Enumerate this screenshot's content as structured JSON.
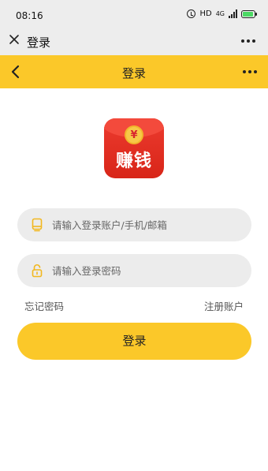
{
  "status_bar": {
    "time": "08:16",
    "hd": "HD",
    "network": "4G",
    "battery_text": "92"
  },
  "wx_bar": {
    "title": "登录"
  },
  "nav": {
    "title": "登录"
  },
  "app_icon": {
    "coin_symbol": "¥",
    "text": "赚钱"
  },
  "form": {
    "account_placeholder": "请输入登录账户/手机/邮箱",
    "password_placeholder": "请输入登录密码",
    "forgot_label": "忘记密码",
    "register_label": "注册账户",
    "login_label": "登录"
  },
  "colors": {
    "accent": "#fbc829",
    "input_bg": "#ececec",
    "icon_red": "#e03325"
  }
}
